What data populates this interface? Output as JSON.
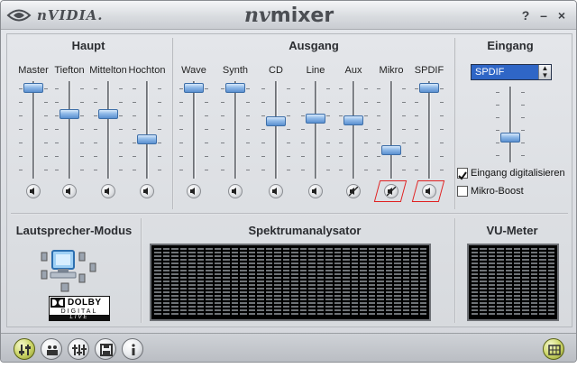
{
  "window": {
    "brand": "nVIDIA.",
    "title_nv": "nv",
    "title_mixer": "mixer",
    "help_label": "?",
    "minimize_label": "–",
    "close_label": "×"
  },
  "sections": {
    "haupt": "Haupt",
    "ausgang": "Ausgang",
    "eingang": "Eingang",
    "speaker_mode": "Lautsprecher-Modus",
    "spectrum": "Spektrumanalysator",
    "vu": "VU-Meter"
  },
  "haupt_channels": [
    {
      "label": "Master",
      "level": 0.98,
      "muted": false
    },
    {
      "label": "Tiefton",
      "level": 0.68,
      "muted": false
    },
    {
      "label": "Mittelton",
      "level": 0.68,
      "muted": false
    },
    {
      "label": "Hochton",
      "level": 0.39,
      "muted": false
    }
  ],
  "ausgang_channels": [
    {
      "label": "Wave",
      "level": 0.98,
      "muted": false,
      "highlighted": false
    },
    {
      "label": "Synth",
      "level": 0.98,
      "muted": false,
      "highlighted": false
    },
    {
      "label": "CD",
      "level": 0.6,
      "muted": false,
      "highlighted": false
    },
    {
      "label": "Line",
      "level": 0.63,
      "muted": false,
      "highlighted": false
    },
    {
      "label": "Aux",
      "level": 0.61,
      "muted": true,
      "highlighted": false
    },
    {
      "label": "Mikro",
      "level": 0.27,
      "muted": true,
      "highlighted": true
    },
    {
      "label": "SPDIF",
      "level": 0.98,
      "muted": false,
      "highlighted": true
    }
  ],
  "eingang": {
    "source": "SPDIF",
    "level": 0.3,
    "digitize_label": "Eingang digitalisieren",
    "digitize_checked": true,
    "boost_label": "Mikro-Boost",
    "boost_checked": false
  },
  "dolby": {
    "word": "DOLBY",
    "sub": "DIGITAL",
    "live": "LIVE"
  },
  "bottom_buttons": [
    {
      "name": "mixer-icon",
      "active": true
    },
    {
      "name": "speaker-setup-icon",
      "active": false
    },
    {
      "name": "equalizer-icon",
      "active": false
    },
    {
      "name": "presets-icon",
      "active": false
    },
    {
      "name": "info-icon",
      "active": false
    },
    {
      "name": "keypad-icon",
      "active": true
    }
  ]
}
